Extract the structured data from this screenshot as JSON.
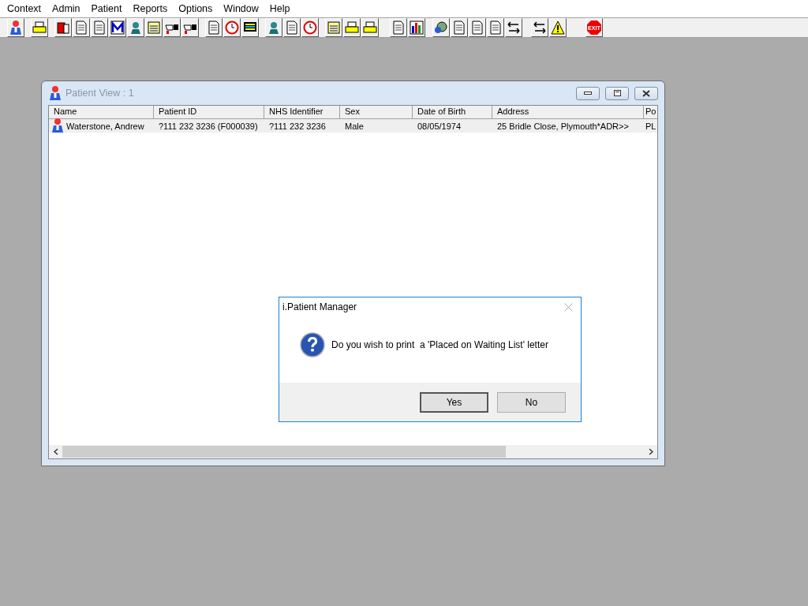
{
  "menu_bar": [
    "Context",
    "Admin",
    "Patient",
    "Reports",
    "Options",
    "Window",
    "Help"
  ],
  "toolbar": {
    "exit_label": "EXIT"
  },
  "patient_window": {
    "title": "Patient View : 1",
    "columns": [
      "Name",
      "Patient ID",
      "NHS Identifier",
      "Sex",
      "Date of Birth",
      "Address",
      "Po"
    ],
    "rows": [
      {
        "cells": [
          "Waterstone, Andrew",
          "?111 232 3236 (F000039)",
          "?111 232 3236",
          "Male",
          "08/05/1974",
          "25 Bridle Close, Plymouth*ADR>>",
          "PL"
        ],
        "selected": true
      }
    ]
  },
  "dialog": {
    "title": "i.Patient Manager",
    "message": "Do you wish to print  a 'Placed on Waiting List' letter",
    "buttons": [
      "Yes",
      "No"
    ]
  }
}
